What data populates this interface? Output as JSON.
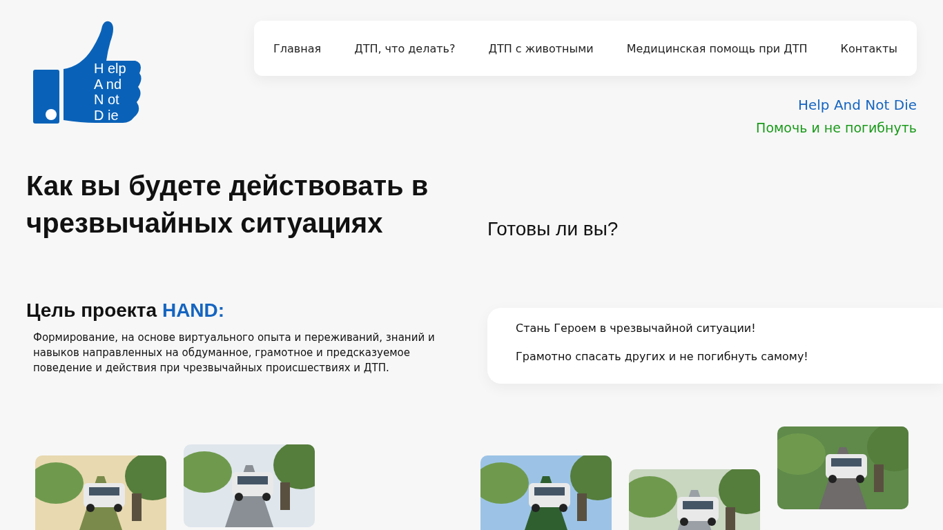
{
  "logo": {
    "lines": [
      "H elp",
      "A nd",
      "N ot",
      "D ie"
    ]
  },
  "nav": [
    {
      "label": "Главная"
    },
    {
      "label": "ДТП, что делать?"
    },
    {
      "label": "ДТП с животными"
    },
    {
      "label": "Медицинская помощь при ДТП"
    },
    {
      "label": "Контакты"
    }
  ],
  "tagline_en": "Help And Not Die",
  "tagline_ru": "Помочь и не погибнуть",
  "heading": "Как вы будете действовать в чрезвычайных ситуациях",
  "question": "Готовы ли вы?",
  "goal": {
    "title": "Цель проекта",
    "highlight": "HAND:",
    "text": "Формирование, на основе виртуального опыта и переживаний, знаний и навыков направленных на обдуманное, грамотное и предсказуемое поведение и действия при чрезвычайных происшествиях и ДТП."
  },
  "callout": [
    "Стань Героем в чрезвычайной ситуации!",
    "Грамотно спасать других и не погибнуть самому!"
  ]
}
